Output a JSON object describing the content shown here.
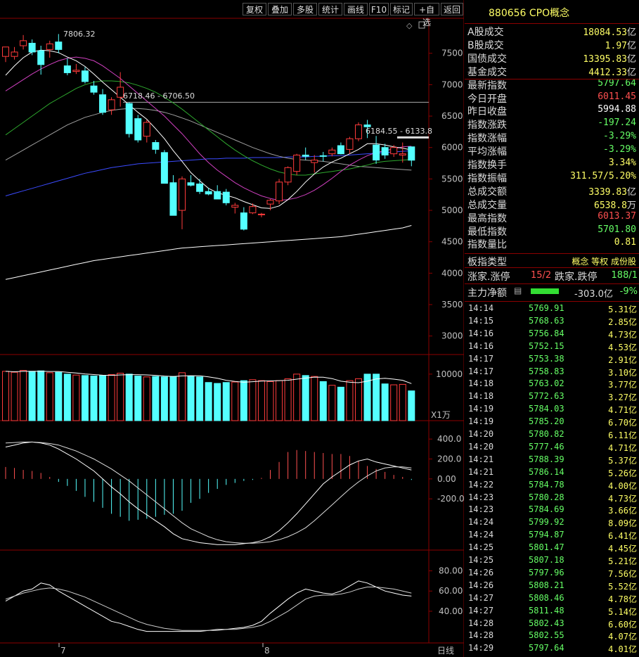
{
  "toolbar": {
    "buttons": [
      "复权",
      "叠加",
      "多股",
      "统计",
      "画线",
      "F10",
      "标记",
      "+自选",
      "返回"
    ]
  },
  "header": {
    "title": "880656 CPO概念"
  },
  "colors": {
    "up": "#ff3b3b",
    "down": "#54ffff",
    "flat": "#ffffff",
    "label": "#dcdcdc",
    "yellow": "#ffff66",
    "green": "#66ff66"
  },
  "quotes": [
    {
      "label": "A股成交",
      "value": "18084.53",
      "unit": "亿",
      "color": "#ffff66"
    },
    {
      "label": "B股成交",
      "value": "1.97",
      "unit": "亿",
      "color": "#ffff66"
    },
    {
      "label": "国债成交",
      "value": "13395.83",
      "unit": "亿",
      "color": "#ffff66"
    },
    {
      "label": "基金成交",
      "value": "4412.33",
      "unit": "亿",
      "color": "#ffff66"
    },
    {
      "label": "最新指数",
      "value": "5797.64",
      "unit": "",
      "color": "#66ff66"
    },
    {
      "label": "今日开盘",
      "value": "6011.45",
      "unit": "",
      "color": "#ff5050"
    },
    {
      "label": "昨日收盘",
      "value": "5994.88",
      "unit": "",
      "color": "#ffffff"
    },
    {
      "label": "指数涨跌",
      "value": "-197.24",
      "unit": "",
      "color": "#66ff66"
    },
    {
      "label": "指数涨幅",
      "value": "-3.29%",
      "unit": "",
      "color": "#66ff66"
    },
    {
      "label": "平均涨幅",
      "value": "-3.29%",
      "unit": "",
      "color": "#66ff66"
    },
    {
      "label": "指数换手",
      "value": "3.34%",
      "unit": "",
      "color": "#ffff66"
    },
    {
      "label": "指数振幅",
      "value": "311.57/5.20%",
      "unit": "",
      "color": "#ffff66"
    },
    {
      "label": "总成交额",
      "value": "3339.83",
      "unit": "亿",
      "color": "#ffff66"
    },
    {
      "label": "总成交量",
      "value": "6538.8",
      "unit": "万",
      "color": "#ffff66"
    },
    {
      "label": "最高指数",
      "value": "6013.37",
      "unit": "",
      "color": "#ff5050"
    },
    {
      "label": "最低指数",
      "value": "5701.80",
      "unit": "",
      "color": "#66ff66"
    },
    {
      "label": "指数量比",
      "value": "0.81",
      "unit": "",
      "color": "#ffff66"
    }
  ],
  "board": {
    "label": "板指类型",
    "value": "概念 等权 成份股",
    "up_label": "涨家.涨停",
    "up_value": "15/2",
    "down_label": "跌家.跌停",
    "down_value": "188/1",
    "flow_label": "主力净额",
    "flow_value": "-303.0亿",
    "flow_pct": "-9%"
  },
  "ticks": [
    {
      "time": "14:14",
      "price": "5769.91",
      "vol": "5.31亿"
    },
    {
      "time": "14:15",
      "price": "5768.63",
      "vol": "2.85亿"
    },
    {
      "time": "14:16",
      "price": "5756.84",
      "vol": "4.73亿"
    },
    {
      "time": "14:16",
      "price": "5752.15",
      "vol": "4.53亿"
    },
    {
      "time": "14:17",
      "price": "5753.38",
      "vol": "2.91亿"
    },
    {
      "time": "14:17",
      "price": "5758.83",
      "vol": "3.10亿"
    },
    {
      "time": "14:18",
      "price": "5763.02",
      "vol": "3.77亿"
    },
    {
      "time": "14:18",
      "price": "5772.63",
      "vol": "3.27亿"
    },
    {
      "time": "14:19",
      "price": "5784.03",
      "vol": "4.71亿"
    },
    {
      "time": "14:19",
      "price": "5785.20",
      "vol": "6.70亿"
    },
    {
      "time": "14:20",
      "price": "5780.82",
      "vol": "6.11亿"
    },
    {
      "time": "14:20",
      "price": "5777.46",
      "vol": "4.71亿"
    },
    {
      "time": "14:21",
      "price": "5788.39",
      "vol": "5.37亿"
    },
    {
      "time": "14:21",
      "price": "5786.14",
      "vol": "5.26亿"
    },
    {
      "time": "14:22",
      "price": "5784.78",
      "vol": "4.00亿"
    },
    {
      "time": "14:23",
      "price": "5780.28",
      "vol": "4.73亿"
    },
    {
      "time": "14:23",
      "price": "5784.69",
      "vol": "3.66亿"
    },
    {
      "time": "14:24",
      "price": "5799.92",
      "vol": "8.09亿"
    },
    {
      "time": "14:24",
      "price": "5794.87",
      "vol": "6.41亿"
    },
    {
      "time": "14:25",
      "price": "5801.47",
      "vol": "4.45亿"
    },
    {
      "time": "14:25",
      "price": "5807.18",
      "vol": "5.21亿"
    },
    {
      "time": "14:26",
      "price": "5797.96",
      "vol": "7.56亿"
    },
    {
      "time": "14:26",
      "price": "5808.21",
      "vol": "5.52亿"
    },
    {
      "time": "14:27",
      "price": "5808.46",
      "vol": "4.78亿"
    },
    {
      "time": "14:27",
      "price": "5811.48",
      "vol": "5.14亿"
    },
    {
      "time": "14:28",
      "price": "5802.43",
      "vol": "6.60亿"
    },
    {
      "time": "14:28",
      "price": "5802.55",
      "vol": "4.07亿"
    },
    {
      "time": "14:29",
      "price": "5797.64",
      "vol": "4.01亿"
    }
  ],
  "chart_data": {
    "type": "candlestick",
    "price_axis": {
      "ticks": [
        "7500",
        "7000",
        "6500",
        "6000",
        "5500",
        "5000",
        "4500",
        "4000",
        "3500",
        "3000"
      ],
      "range": [
        2750,
        7900
      ]
    },
    "annotations": [
      "7806.32",
      "6718.46 - 6706.50",
      "6184.55 - 6133.8"
    ],
    "volume_axis": {
      "ticks": [
        "10000"
      ],
      "unit": "X1万"
    },
    "macd_axis": {
      "ticks": [
        "400.0",
        "200.0",
        "0.00",
        "-200.0"
      ],
      "range": [
        -700,
        500
      ]
    },
    "kdj_axis": {
      "ticks": [
        "80.00",
        "60.00",
        "40.00"
      ],
      "range": [
        10,
        95
      ]
    },
    "date_labels": [
      "7",
      "8"
    ],
    "period": "日线",
    "candles": [
      {
        "o": 7450,
        "h": 7560,
        "l": 7360,
        "c": 7600
      },
      {
        "o": 7450,
        "h": 7600,
        "l": 7400,
        "c": 7520
      },
      {
        "o": 7620,
        "h": 7790,
        "l": 7560,
        "c": 7700
      },
      {
        "o": 7660,
        "h": 7720,
        "l": 7470,
        "c": 7520
      },
      {
        "o": 7540,
        "h": 7620,
        "l": 7160,
        "c": 7320
      },
      {
        "o": 7560,
        "h": 7700,
        "l": 7430,
        "c": 7650
      },
      {
        "o": 7680,
        "h": 7806,
        "l": 7500,
        "c": 7560
      },
      {
        "o": 7300,
        "h": 7420,
        "l": 7150,
        "c": 7190
      },
      {
        "o": 7210,
        "h": 7330,
        "l": 7170,
        "c": 7230
      },
      {
        "o": 7220,
        "h": 7280,
        "l": 7020,
        "c": 7050
      },
      {
        "o": 6980,
        "h": 7060,
        "l": 6840,
        "c": 6880
      },
      {
        "o": 6840,
        "h": 6930,
        "l": 6520,
        "c": 6560
      },
      {
        "o": 6600,
        "h": 6800,
        "l": 6520,
        "c": 6760
      },
      {
        "o": 6800,
        "h": 7200,
        "l": 6650,
        "c": 6960
      },
      {
        "o": 6700,
        "h": 6720,
        "l": 6160,
        "c": 6220
      },
      {
        "o": 6460,
        "h": 6520,
        "l": 6080,
        "c": 6120
      },
      {
        "o": 6180,
        "h": 6440,
        "l": 6080,
        "c": 6400
      },
      {
        "o": 6080,
        "h": 6120,
        "l": 5900,
        "c": 5970
      },
      {
        "o": 5920,
        "h": 5960,
        "l": 5560,
        "c": 5430
      },
      {
        "o": 5440,
        "h": 5560,
        "l": 4920,
        "c": 4920
      },
      {
        "o": 5000,
        "h": 5540,
        "l": 4700,
        "c": 5500
      },
      {
        "o": 5440,
        "h": 5560,
        "l": 5380,
        "c": 5400
      },
      {
        "o": 5420,
        "h": 5500,
        "l": 5260,
        "c": 5300
      },
      {
        "o": 5300,
        "h": 5360,
        "l": 5240,
        "c": 5260
      },
      {
        "o": 5300,
        "h": 5400,
        "l": 5180,
        "c": 5180
      },
      {
        "o": 5290,
        "h": 5340,
        "l": 5080,
        "c": 5120
      },
      {
        "o": 5050,
        "h": 5120,
        "l": 4950,
        "c": 5080
      },
      {
        "o": 4960,
        "h": 5050,
        "l": 4680,
        "c": 4700
      },
      {
        "o": 4960,
        "h": 5110,
        "l": 4940,
        "c": 5060
      },
      {
        "o": 4930,
        "h": 4960,
        "l": 4890,
        "c": 4940
      },
      {
        "o": 5100,
        "h": 5180,
        "l": 5000,
        "c": 5160
      },
      {
        "o": 5150,
        "h": 5500,
        "l": 5100,
        "c": 5450
      },
      {
        "o": 5450,
        "h": 5700,
        "l": 5400,
        "c": 5680
      },
      {
        "o": 5620,
        "h": 5900,
        "l": 5560,
        "c": 5880
      },
      {
        "o": 5880,
        "h": 6000,
        "l": 5800,
        "c": 5860
      },
      {
        "o": 5760,
        "h": 5880,
        "l": 5600,
        "c": 5800
      },
      {
        "o": 5870,
        "h": 5930,
        "l": 5780,
        "c": 5860
      },
      {
        "o": 5900,
        "h": 6000,
        "l": 5860,
        "c": 5960
      },
      {
        "o": 6030,
        "h": 6080,
        "l": 5890,
        "c": 5900
      },
      {
        "o": 5970,
        "h": 6170,
        "l": 5900,
        "c": 6140
      },
      {
        "o": 6140,
        "h": 6400,
        "l": 6100,
        "c": 6360
      },
      {
        "o": 6360,
        "h": 6440,
        "l": 6150,
        "c": 6330
      },
      {
        "o": 6040,
        "h": 6184,
        "l": 5740,
        "c": 5800
      },
      {
        "o": 6000,
        "h": 6060,
        "l": 5820,
        "c": 5880
      },
      {
        "o": 5900,
        "h": 6040,
        "l": 5850,
        "c": 6000
      },
      {
        "o": 5880,
        "h": 6080,
        "l": 5760,
        "c": 5900
      },
      {
        "o": 6011,
        "h": 6013,
        "l": 5702,
        "c": 5798
      }
    ],
    "volumes": [
      10600,
      10400,
      10800,
      10600,
      10700,
      10300,
      10400,
      10000,
      9800,
      9700,
      9600,
      9700,
      9900,
      10200,
      10000,
      9600,
      9400,
      9500,
      9400,
      9500,
      10300,
      9600,
      9400,
      8200,
      8000,
      8200,
      8300,
      8600,
      8800,
      8600,
      8400,
      8600,
      9000,
      10000,
      9700,
      9500,
      8400,
      7600,
      7200,
      8600,
      9000,
      10000,
      10000,
      7900,
      7700,
      7800,
      6400
    ],
    "ma5": [
      7150,
      7300,
      7430,
      7520,
      7550,
      7540,
      7510,
      7440,
      7380,
      7290,
      7170,
      7040,
      6920,
      6800,
      6680,
      6560,
      6450,
      6300,
      6140,
      5950,
      5780,
      5600,
      5470,
      5350,
      5280,
      5240,
      5200,
      5140,
      5090,
      5040,
      5030,
      5070,
      5170,
      5300,
      5450,
      5580,
      5690,
      5770,
      5830,
      5900,
      5970,
      6060,
      6060,
      6040,
      6010,
      5990,
      5960
    ],
    "ma10": [
      6900,
      6990,
      7080,
      7170,
      7250,
      7320,
      7380,
      7420,
      7440,
      7420,
      7380,
      7300,
      7200,
      7100,
      6980,
      6860,
      6740,
      6620,
      6500,
      6360,
      6220,
      6060,
      5900,
      5760,
      5640,
      5540,
      5440,
      5360,
      5290,
      5230,
      5190,
      5160,
      5170,
      5200,
      5250,
      5320,
      5410,
      5510,
      5620,
      5720,
      5800,
      5870,
      5920,
      5950,
      5980,
      6010,
      6020
    ],
    "ma20": [
      6200,
      6300,
      6400,
      6500,
      6600,
      6700,
      6780,
      6860,
      6940,
      7000,
      7040,
      7060,
      7060,
      7050,
      7030,
      6990,
      6940,
      6880,
      6800,
      6710,
      6610,
      6500,
      6390,
      6280,
      6170,
      6060,
      5960,
      5870,
      5790,
      5720,
      5660,
      5610,
      5580,
      5560,
      5560,
      5580,
      5600,
      5620,
      5640,
      5660,
      5690,
      5720,
      5760,
      5780,
      5790,
      5800,
      5810
    ],
    "ma30": [
      5800,
      5880,
      5960,
      6040,
      6120,
      6200,
      6280,
      6360,
      6420,
      6480,
      6520,
      6560,
      6590,
      6610,
      6620,
      6620,
      6610,
      6590,
      6560,
      6520,
      6470,
      6420,
      6360,
      6300,
      6240,
      6180,
      6120,
      6060,
      6000,
      5950,
      5900,
      5860,
      5830,
      5810,
      5800,
      5790,
      5780,
      5760,
      5740,
      5720,
      5700,
      5690,
      5680,
      5670,
      5660,
      5650,
      5640
    ],
    "ma60": [
      5230,
      5270,
      5310,
      5350,
      5390,
      5430,
      5470,
      5510,
      5550,
      5590,
      5620,
      5650,
      5680,
      5700,
      5720,
      5740,
      5750,
      5760,
      5770,
      5780,
      5790,
      5800,
      5810,
      5820,
      5820,
      5830,
      5830,
      5830,
      5840,
      5840,
      5840,
      5840,
      5850,
      5850,
      5850,
      5860,
      5860,
      5870,
      5870,
      5880,
      5890,
      5900,
      5910,
      5920,
      5930,
      5940,
      5950
    ],
    "ma250": [
      3900,
      3930,
      3960,
      3990,
      4020,
      4050,
      4080,
      4110,
      4140,
      4170,
      4200,
      4220,
      4240,
      4260,
      4280,
      4300,
      4320,
      4340,
      4360,
      4380,
      4400,
      4410,
      4420,
      4430,
      4440,
      4450,
      4460,
      4470,
      4480,
      4490,
      4500,
      4510,
      4520,
      4530,
      4540,
      4550,
      4560,
      4570,
      4580,
      4600,
      4620,
      4640,
      4660,
      4680,
      4700,
      4720,
      4760
    ],
    "macd_dif": [
      320,
      340,
      360,
      370,
      360,
      340,
      300,
      250,
      200,
      140,
      80,
      0,
      -80,
      -150,
      -230,
      -300,
      -360,
      -420,
      -480,
      -550,
      -600,
      -620,
      -640,
      -650,
      -660,
      -660,
      -660,
      -650,
      -640,
      -620,
      -580,
      -520,
      -440,
      -350,
      -250,
      -150,
      -50,
      20,
      80,
      140,
      180,
      200,
      170,
      150,
      130,
      110,
      90
    ],
    "macd_dea": [
      360,
      365,
      370,
      370,
      365,
      355,
      340,
      310,
      280,
      240,
      200,
      150,
      100,
      40,
      -20,
      -90,
      -160,
      -230,
      -300,
      -370,
      -440,
      -500,
      -540,
      -580,
      -610,
      -630,
      -640,
      -645,
      -645,
      -640,
      -630,
      -610,
      -580,
      -540,
      -490,
      -420,
      -340,
      -260,
      -180,
      -100,
      -30,
      30,
      80,
      110,
      120,
      120,
      110
    ],
    "macd_bar": [
      120,
      110,
      90,
      80,
      60,
      20,
      -30,
      -70,
      -120,
      -180,
      -230,
      -290,
      -350,
      -380,
      -420,
      -410,
      -400,
      -380,
      -360,
      -350,
      -320,
      -240,
      -200,
      -140,
      -100,
      -60,
      -40,
      -20,
      -10,
      10,
      90,
      170,
      270,
      290,
      280,
      270,
      260,
      250,
      250,
      230,
      180,
      130,
      100,
      70,
      40,
      20,
      -10
    ],
    "kdj_k": [
      50,
      55,
      60,
      62,
      68,
      66,
      60,
      55,
      50,
      45,
      40,
      35,
      30,
      28,
      25,
      22,
      20,
      20,
      20,
      20,
      20,
      20,
      20,
      21,
      22,
      22,
      23,
      24,
      26,
      30,
      38,
      45,
      52,
      58,
      62,
      60,
      58,
      57,
      60,
      65,
      70,
      68,
      64,
      60,
      58,
      56,
      55
    ],
    "kdj_d": [
      52,
      55,
      58,
      60,
      62,
      63,
      62,
      60,
      57,
      54,
      50,
      46,
      42,
      38,
      34,
      30,
      27,
      25,
      23,
      22,
      21,
      21,
      21,
      21,
      21,
      22,
      22,
      23,
      24,
      26,
      30,
      35,
      40,
      46,
      52,
      55,
      56,
      56,
      57,
      59,
      62,
      64,
      64,
      63,
      62,
      60,
      58
    ]
  }
}
